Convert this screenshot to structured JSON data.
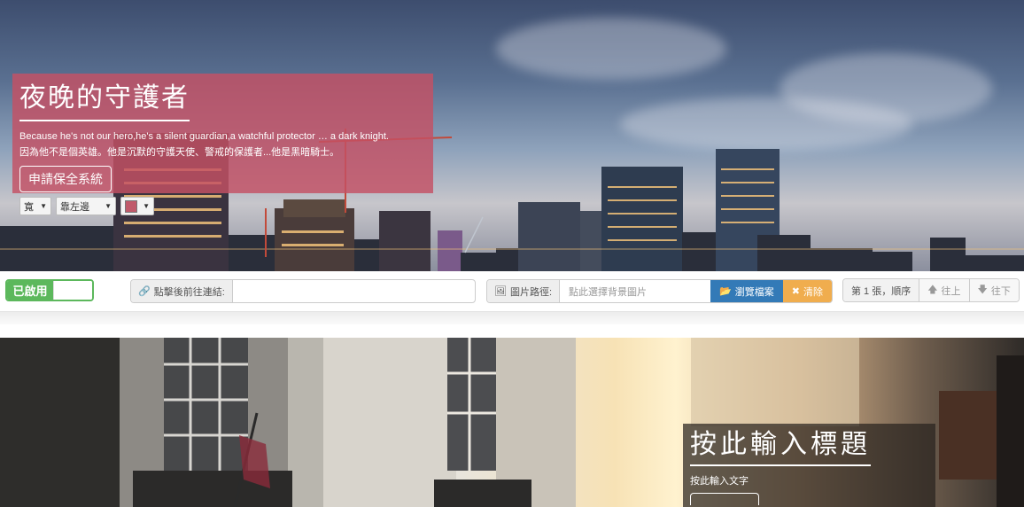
{
  "hero": {
    "title": "夜晚的守護者",
    "line_en": "Because he's not our hero,he's a silent guardian,a watchful protector … a dark knight.",
    "line_zh": "因為他不是個英雄。他是沉默的守護天使、警戒的保護者...他是黑暗騎士。",
    "button_label": "申請保全系統",
    "controls": {
      "width_label": "寬",
      "align_label": "靠左邊",
      "color_value": "#c05a6a"
    }
  },
  "toolbar": {
    "toggle_label": "已啟用",
    "link": {
      "label": "點擊後前往連結:",
      "value": ""
    },
    "image": {
      "label": "圖片路徑:",
      "placeholder": "點此選擇背景圖片",
      "browse_label": "瀏覽檔案",
      "clear_label": "清除"
    },
    "order": {
      "position_label": "第 1 張，順序",
      "up_label": "往上",
      "down_label": "往下"
    }
  },
  "second": {
    "title": "按此輸入標題",
    "text": "按此輸入文字"
  },
  "colors": {
    "caption_red": "#c45064",
    "toggle_green": "#5cb85c",
    "primary_blue": "#337ab7",
    "warning_orange": "#f0ad4e"
  }
}
